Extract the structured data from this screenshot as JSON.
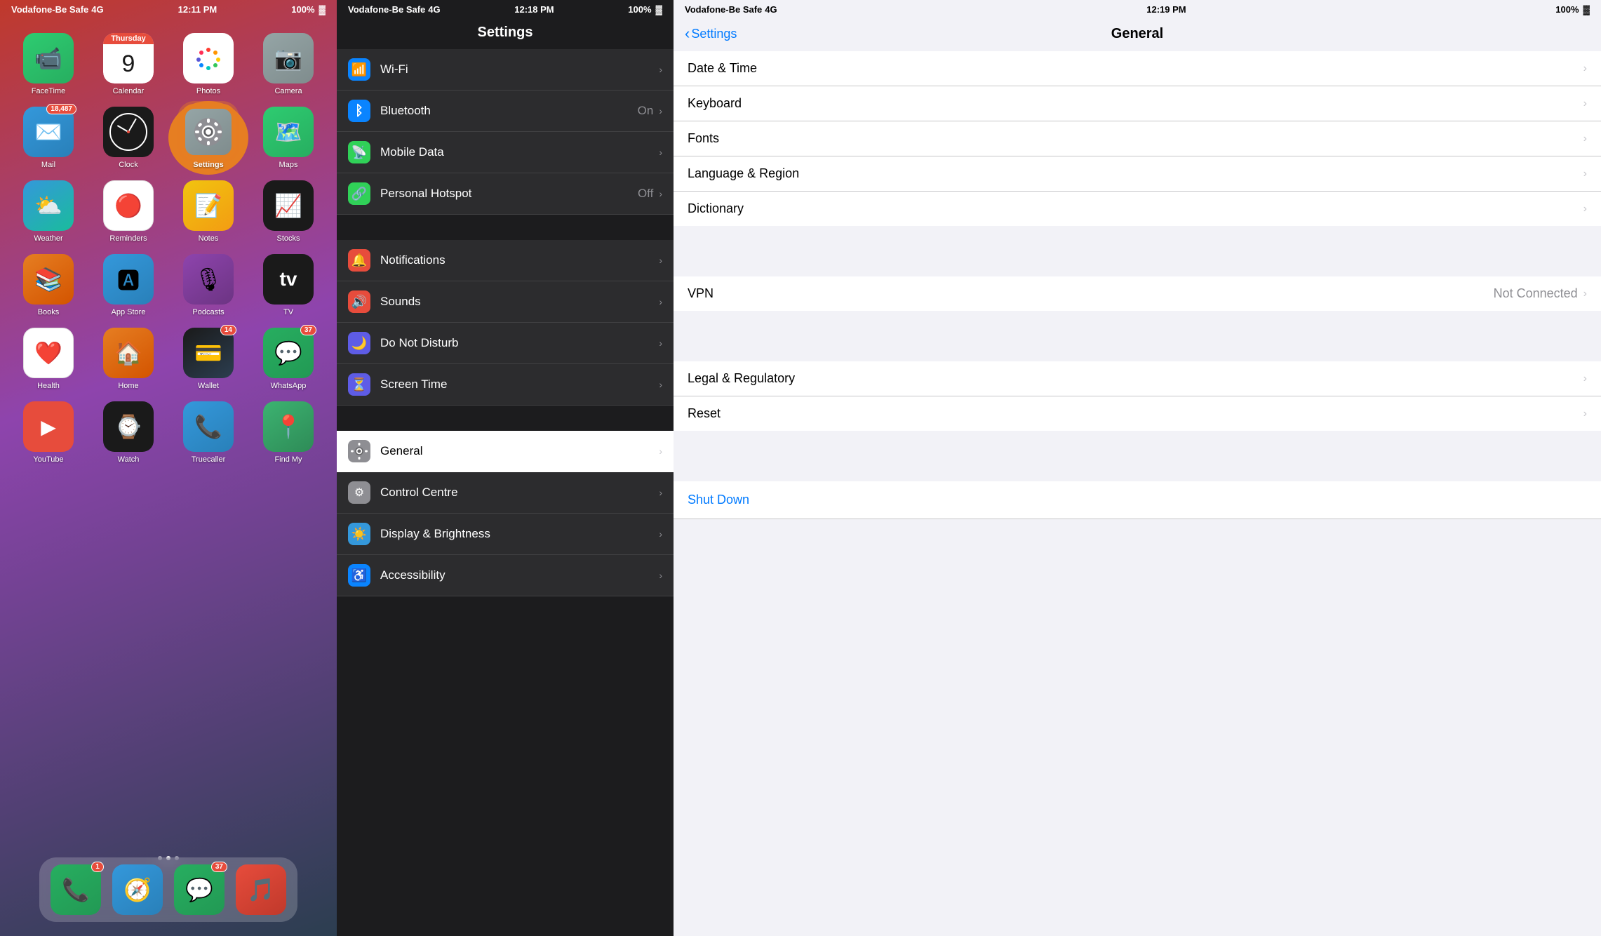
{
  "panel1": {
    "carrier": "Vodafone-Be Safe",
    "network": "4G",
    "time": "12:11 PM",
    "battery": "100%",
    "apps": [
      {
        "id": "facetime",
        "label": "FaceTime",
        "emoji": "📹",
        "bg": "bg-facetime"
      },
      {
        "id": "calendar",
        "label": "Calendar",
        "special": "calendar"
      },
      {
        "id": "photos",
        "label": "Photos",
        "emoji": "🌈",
        "bg": "bg-photos"
      },
      {
        "id": "camera",
        "label": "Camera",
        "emoji": "📷",
        "bg": "bg-camera"
      },
      {
        "id": "mail",
        "label": "Mail",
        "emoji": "✉️",
        "bg": "bg-mail",
        "badge": "18,487"
      },
      {
        "id": "clock",
        "label": "Clock",
        "special": "clock"
      },
      {
        "id": "settings",
        "label": "Settings",
        "emoji": "⚙️",
        "bg": "bg-settings",
        "highlighted": true
      },
      {
        "id": "maps",
        "label": "Maps",
        "emoji": "🗺️",
        "bg": "bg-maps"
      },
      {
        "id": "weather",
        "label": "Weather",
        "emoji": "⛅",
        "bg": "bg-weather"
      },
      {
        "id": "reminders",
        "label": "Reminders",
        "emoji": "🔴",
        "bg": "bg-reminders"
      },
      {
        "id": "notes",
        "label": "Notes",
        "emoji": "📝",
        "bg": "bg-notes"
      },
      {
        "id": "stocks",
        "label": "Stocks",
        "emoji": "📈",
        "bg": "bg-stocks"
      },
      {
        "id": "books",
        "label": "Books",
        "emoji": "📚",
        "bg": "bg-books"
      },
      {
        "id": "appstore",
        "label": "App Store",
        "emoji": "🅰",
        "bg": "bg-appstore"
      },
      {
        "id": "podcasts",
        "label": "Podcasts",
        "emoji": "🎙",
        "bg": "bg-podcasts"
      },
      {
        "id": "tv",
        "label": "TV",
        "emoji": "📺",
        "bg": "bg-tv"
      },
      {
        "id": "health",
        "label": "Health",
        "emoji": "❤️",
        "bg": "bg-health"
      },
      {
        "id": "home",
        "label": "Home",
        "emoji": "🏠",
        "bg": "bg-home"
      },
      {
        "id": "wallet",
        "label": "Wallet",
        "emoji": "💳",
        "bg": "bg-wallet",
        "badge": "14"
      },
      {
        "id": "whatsapp",
        "label": "WhatsApp",
        "emoji": "💬",
        "bg": "bg-whatsapp",
        "badge": "37"
      },
      {
        "id": "youtube",
        "label": "YouTube",
        "emoji": "▶",
        "bg": "bg-youtube"
      },
      {
        "id": "watch",
        "label": "Watch",
        "emoji": "⌚",
        "bg": "bg-watch"
      },
      {
        "id": "truecaller",
        "label": "Truecaller",
        "emoji": "📞",
        "bg": "bg-truecaller"
      },
      {
        "id": "findmy",
        "label": "Find My",
        "emoji": "📍",
        "bg": "bg-findmy"
      }
    ],
    "dock": [
      {
        "id": "phone",
        "label": "Phone",
        "emoji": "📞",
        "bg": "bg-phone",
        "badge": "1"
      },
      {
        "id": "safari",
        "label": "Safari",
        "emoji": "🧭",
        "bg": "bg-safari"
      },
      {
        "id": "messages",
        "label": "Messages",
        "emoji": "💬",
        "bg": "bg-messages",
        "badge": "37"
      },
      {
        "id": "music",
        "label": "Music",
        "emoji": "🎵",
        "bg": "bg-music"
      }
    ],
    "calendar_day": "9",
    "calendar_day_name": "Thursday"
  },
  "panel2": {
    "carrier": "Vodafone-Be Safe",
    "network": "4G",
    "time": "12:18 PM",
    "battery": "100%",
    "title": "Settings",
    "rows_top": [
      {
        "id": "bluetooth",
        "label": "Bluetooth",
        "value": "On",
        "icon_bg": "#0a84ff",
        "icon": "bluetooth"
      },
      {
        "id": "mobile-data",
        "label": "Mobile Data",
        "value": "",
        "icon_bg": "#30d158",
        "icon": "mobile"
      },
      {
        "id": "personal-hotspot",
        "label": "Personal Hotspot",
        "value": "Off",
        "icon_bg": "#30d158",
        "icon": "hotspot"
      }
    ],
    "rows_mid": [
      {
        "id": "notifications",
        "label": "Notifications",
        "value": "",
        "icon_bg": "#e74c3c",
        "icon": "bell"
      },
      {
        "id": "sounds",
        "label": "Sounds",
        "value": "",
        "icon_bg": "#e74c3c",
        "icon": "sound"
      },
      {
        "id": "do-not-disturb",
        "label": "Do Not Disturb",
        "value": "",
        "icon_bg": "#5e5ce6",
        "icon": "moon"
      },
      {
        "id": "screen-time",
        "label": "Screen Time",
        "value": "",
        "icon_bg": "#5e5ce6",
        "icon": "hourglass"
      }
    ],
    "rows_bottom": [
      {
        "id": "general",
        "label": "General",
        "value": "",
        "icon_bg": "#8e8e93",
        "icon": "gear",
        "white": true
      },
      {
        "id": "control-centre",
        "label": "Control Centre",
        "value": "",
        "icon_bg": "#8e8e93",
        "icon": "control"
      },
      {
        "id": "display-brightness",
        "label": "Display & Brightness",
        "value": "",
        "icon_bg": "#3498db",
        "icon": "brightness"
      },
      {
        "id": "accessibility",
        "label": "Accessibility",
        "value": "",
        "icon_bg": "#0a84ff",
        "icon": "accessibility"
      }
    ]
  },
  "panel3": {
    "carrier": "Vodafone-Be Safe",
    "network": "4G",
    "time": "12:19 PM",
    "battery": "100%",
    "back_label": "Settings",
    "title": "General",
    "section1": [
      {
        "id": "date-time",
        "label": "Date & Time",
        "value": ""
      },
      {
        "id": "keyboard",
        "label": "Keyboard",
        "value": ""
      },
      {
        "id": "fonts",
        "label": "Fonts",
        "value": ""
      },
      {
        "id": "language-region",
        "label": "Language & Region",
        "value": ""
      },
      {
        "id": "dictionary",
        "label": "Dictionary",
        "value": ""
      }
    ],
    "section2": [
      {
        "id": "vpn",
        "label": "VPN",
        "value": "Not Connected"
      }
    ],
    "section3": [
      {
        "id": "legal-regulatory",
        "label": "Legal & Regulatory",
        "value": ""
      },
      {
        "id": "reset",
        "label": "Reset",
        "value": ""
      }
    ],
    "shutdown_label": "Shut Down"
  }
}
